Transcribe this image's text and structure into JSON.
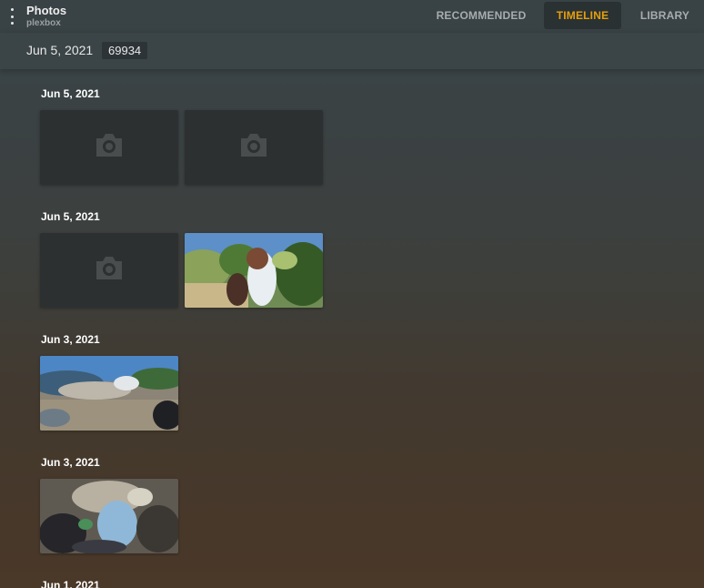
{
  "app": {
    "title": "Photos",
    "subtitle": "plexbox"
  },
  "nav": {
    "tabs": [
      {
        "label": "RECOMMENDED",
        "active": false
      },
      {
        "label": "TIMELINE",
        "active": true
      },
      {
        "label": "LIBRARY",
        "active": false
      }
    ]
  },
  "subbar": {
    "current_date": "Jun 5, 2021",
    "count": "69934"
  },
  "groups": [
    {
      "date": "Jun 5, 2021",
      "items": [
        "placeholder",
        "placeholder"
      ]
    },
    {
      "date": "Jun 5, 2021",
      "items": [
        "placeholder",
        "photo"
      ]
    },
    {
      "date": "Jun 3, 2021",
      "items": [
        "photo"
      ]
    },
    {
      "date": "Jun 3, 2021",
      "items": [
        "photo"
      ]
    },
    {
      "date": "Jun 1, 2021",
      "items": []
    }
  ],
  "colors": {
    "accent": "#e5a00d",
    "tile_placeholder": "#2d3031"
  },
  "icons": {
    "placeholder": "camera-icon",
    "menu": "more-vertical-icon"
  }
}
